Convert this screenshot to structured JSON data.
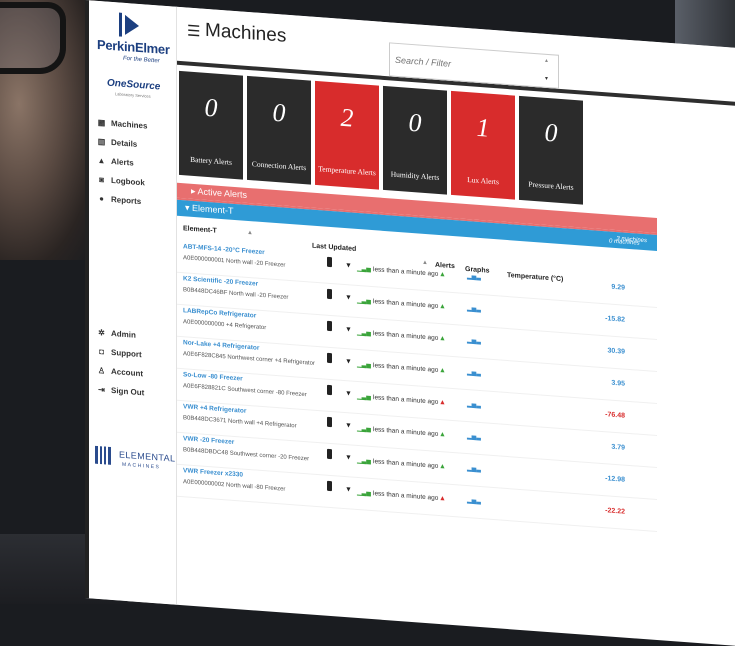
{
  "brand": {
    "name": "PerkinElmer",
    "tagline": "For the Better",
    "product": "OneSource",
    "product_sub": "Laboratory Services",
    "vendor": "ELEMENTAL",
    "vendor_sub": "MACHINES"
  },
  "header": {
    "title": "Machines",
    "search_placeholder": "Search / Filter"
  },
  "nav": {
    "items": [
      {
        "label": "Machines",
        "icon": "grid-icon"
      },
      {
        "label": "Details",
        "icon": "building-icon"
      },
      {
        "label": "Alerts",
        "icon": "bell-icon"
      },
      {
        "label": "Logbook",
        "icon": "book-icon"
      },
      {
        "label": "Reports",
        "icon": "report-icon"
      }
    ],
    "bottom": [
      {
        "label": "Admin",
        "icon": "gear-icon"
      },
      {
        "label": "Support",
        "icon": "support-icon"
      },
      {
        "label": "Account",
        "icon": "user-icon"
      },
      {
        "label": "Sign Out",
        "icon": "signout-icon"
      }
    ]
  },
  "tiles": [
    {
      "count": "0",
      "label": "Battery Alerts",
      "alert": false
    },
    {
      "count": "0",
      "label": "Connection Alerts",
      "alert": false
    },
    {
      "count": "2",
      "label": "Temperature Alerts",
      "alert": true
    },
    {
      "count": "0",
      "label": "Humidity Alerts",
      "alert": false
    },
    {
      "count": "1",
      "label": "Lux Alerts",
      "alert": true
    },
    {
      "count": "0",
      "label": "Pressure Alerts",
      "alert": false
    }
  ],
  "active_alerts": {
    "label": "Active Alerts"
  },
  "group": {
    "label": "Element-T",
    "count": "3 machines",
    "sub_count": "0 machines"
  },
  "table": {
    "col_name": "Element-T",
    "col_updated": "Last Updated",
    "col_alerts": "Alerts",
    "col_graphs": "Graphs",
    "col_temp": "Temperature (°C)"
  },
  "machines": [
    {
      "name": "ABT-MFS-14 -20°C Freezer",
      "id": "A0E000000001",
      "location": "North wall",
      "probe": "-20 Freezer",
      "updated": "less than a minute ago",
      "alert": "green",
      "temp": "9.29",
      "temp_state": "blue"
    },
    {
      "name": "K2 Scientific -20 Freezer",
      "id": "B0B448DC46BF",
      "location": "North wall",
      "probe": "-20 Freezer",
      "updated": "less than a minute ago",
      "alert": "green",
      "temp": "-15.82",
      "temp_state": "blue"
    },
    {
      "name": "LABRepCo Refrigerator",
      "id": "A0E000000000",
      "location": "",
      "probe": "+4 Refrigerator",
      "updated": "less than a minute ago",
      "alert": "green",
      "temp": "30.39",
      "temp_state": "blue"
    },
    {
      "name": "Nor-Lake +4 Refrigerator",
      "id": "A0E6F828C845",
      "location": "Northwest corner",
      "probe": "+4 Refrigerator",
      "updated": "less than a minute ago",
      "alert": "green",
      "temp": "3.95",
      "temp_state": "blue"
    },
    {
      "name": "So-Low -80 Freezer",
      "id": "A0E6F828821C",
      "location": "Southwest corner",
      "probe": "-80 Freezer",
      "updated": "less than a minute ago",
      "alert": "red",
      "temp": "-76.48",
      "temp_state": "red"
    },
    {
      "name": "VWR +4 Refrigerator",
      "id": "B0B448DC3671",
      "location": "North wall",
      "probe": "+4 Refrigerator",
      "updated": "less than a minute ago",
      "alert": "green",
      "temp": "3.79",
      "temp_state": "blue"
    },
    {
      "name": "VWR -20 Freezer",
      "id": "B0B448DBDC48",
      "location": "Southwest corner",
      "probe": "-20 Freezer",
      "updated": "less than a minute ago",
      "alert": "green",
      "temp": "-12.98",
      "temp_state": "blue"
    },
    {
      "name": "VWR Freezer x2330",
      "id": "A0E000000002",
      "location": "North wall",
      "probe": "-80 Freezer",
      "updated": "less than a minute ago",
      "alert": "red",
      "temp": "-22.22",
      "temp_state": "red"
    }
  ],
  "colors": {
    "alert_red": "#d82c2c",
    "tile_dark": "#2b2b2b",
    "active_bar": "#e86f6f",
    "group_bar": "#2f9bd6",
    "link_blue": "#3a8fd0"
  }
}
